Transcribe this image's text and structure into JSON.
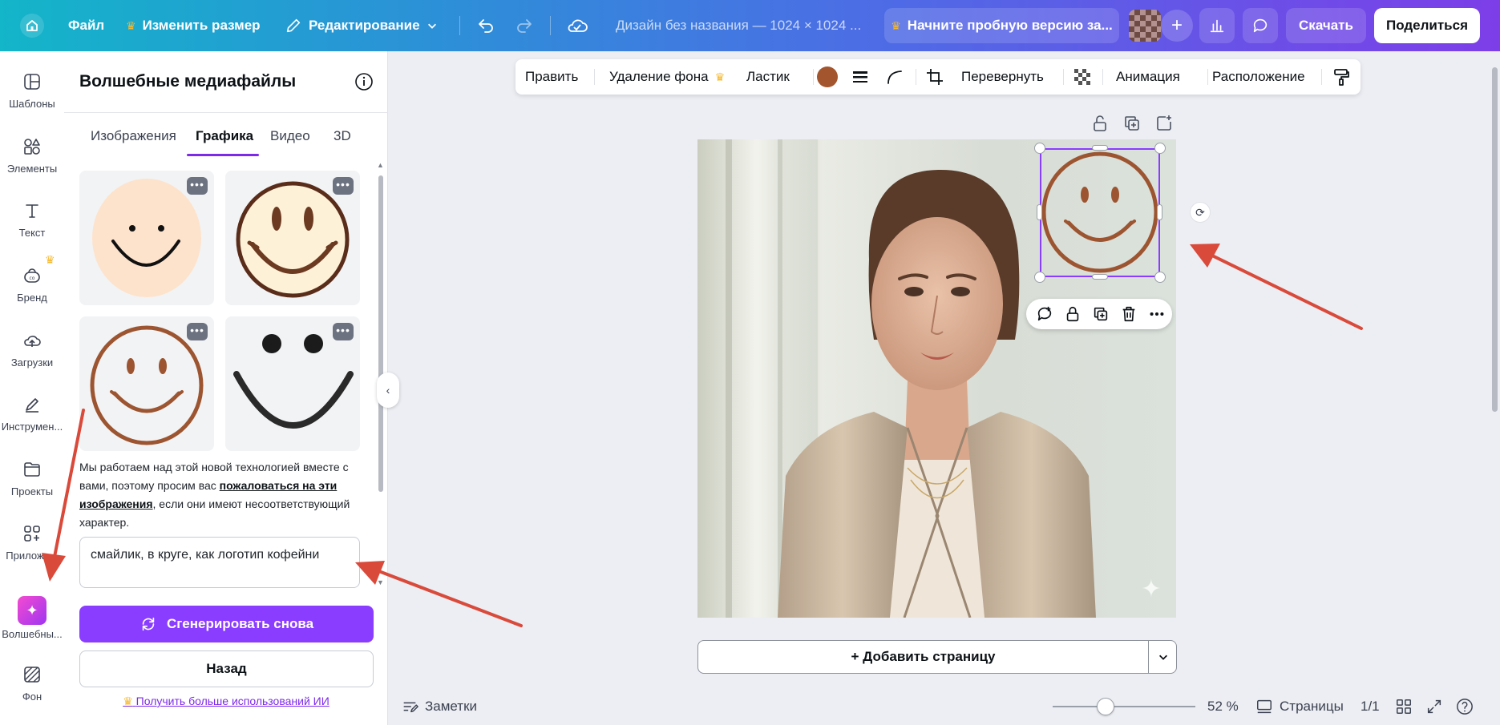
{
  "topbar": {
    "file": "Файл",
    "resize": "Изменить размер",
    "editing": "Редактирование",
    "design_title": "Дизайн без названия — 1024 × 1024 ...",
    "trial": "Начните пробную версию за...",
    "download": "Скачать",
    "share": "Поделиться"
  },
  "rail": {
    "items": [
      {
        "label": "Шаблоны",
        "icon": "templates-icon"
      },
      {
        "label": "Элементы",
        "icon": "elements-icon"
      },
      {
        "label": "Текст",
        "icon": "text-icon"
      },
      {
        "label": "Бренд",
        "icon": "brand-icon"
      },
      {
        "label": "Загрузки",
        "icon": "uploads-icon"
      },
      {
        "label": "Инструмен...",
        "icon": "tools-icon"
      },
      {
        "label": "Проекты",
        "icon": "projects-icon"
      },
      {
        "label": "Приложе...",
        "icon": "apps-icon"
      },
      {
        "label": "Волшебны...",
        "icon": "magic-media-icon"
      },
      {
        "label": "Фон",
        "icon": "background-icon"
      }
    ]
  },
  "panel": {
    "title": "Волшебные медиафайлы",
    "tabs": [
      "Изображения",
      "Графика",
      "Видео",
      "3D"
    ],
    "active_tab": "Графика",
    "more_label": "•••",
    "notice_before": "Мы работаем над этой новой технологией вместе с вами, поэтому просим вас ",
    "notice_link": "пожаловаться на эти изображения",
    "notice_after": ", если они имеют несоответствующий характер.",
    "prompt": "смайлик, в круге, как логотип кофейни",
    "generate_again": "Сгенерировать снова",
    "back": "Назад",
    "more_ai": "Получить больше использований ИИ"
  },
  "context_toolbar": {
    "edit": "Править",
    "remove_bg": "Удаление фона",
    "eraser": "Ластик",
    "color": "#a3552d",
    "flip": "Перевернуть",
    "animate": "Анимация",
    "position": "Расположение"
  },
  "canvas": {
    "add_page": "+ Добавить страницу"
  },
  "bottom": {
    "notes": "Заметки",
    "zoom": "52 %",
    "zoom_fraction": 0.37,
    "pages": "Страницы",
    "page_count": "1/1"
  }
}
